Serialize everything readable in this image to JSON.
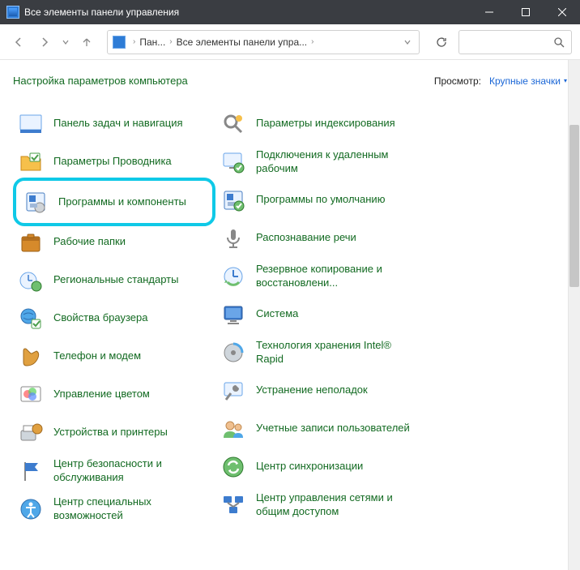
{
  "window": {
    "title": "Все элементы панели управления"
  },
  "breadcrumb": {
    "item1": "Пан...",
    "item2": "Все элементы панели упра..."
  },
  "header": {
    "heading": "Настройка параметров компьютера",
    "view_label": "Просмотр:",
    "view_value": "Крупные значки"
  },
  "left_items": [
    {
      "label": "Панель задач и навигация"
    },
    {
      "label": "Параметры Проводника"
    },
    {
      "label": "Программы и компоненты"
    },
    {
      "label": "Рабочие папки"
    },
    {
      "label": "Региональные стандарты"
    },
    {
      "label": "Свойства браузера"
    },
    {
      "label": "Телефон и модем"
    },
    {
      "label": "Управление цветом"
    },
    {
      "label": "Устройства и принтеры"
    },
    {
      "label": "Центр безопасности и обслуживания"
    },
    {
      "label": "Центр специальных возможностей"
    }
  ],
  "right_items": [
    {
      "label": "Параметры индексирования"
    },
    {
      "label": "Подключения к удаленным рабочим"
    },
    {
      "label": "Программы по умолчанию"
    },
    {
      "label": "Распознавание речи"
    },
    {
      "label": "Резервное копирование и восстановлени..."
    },
    {
      "label": "Система"
    },
    {
      "label": "Технология хранения Intel® Rapid"
    },
    {
      "label": "Устранение неполадок"
    },
    {
      "label": "Учетные записи пользователей"
    },
    {
      "label": "Центр синхронизации"
    },
    {
      "label": "Центр управления сетями и общим доступом"
    }
  ]
}
